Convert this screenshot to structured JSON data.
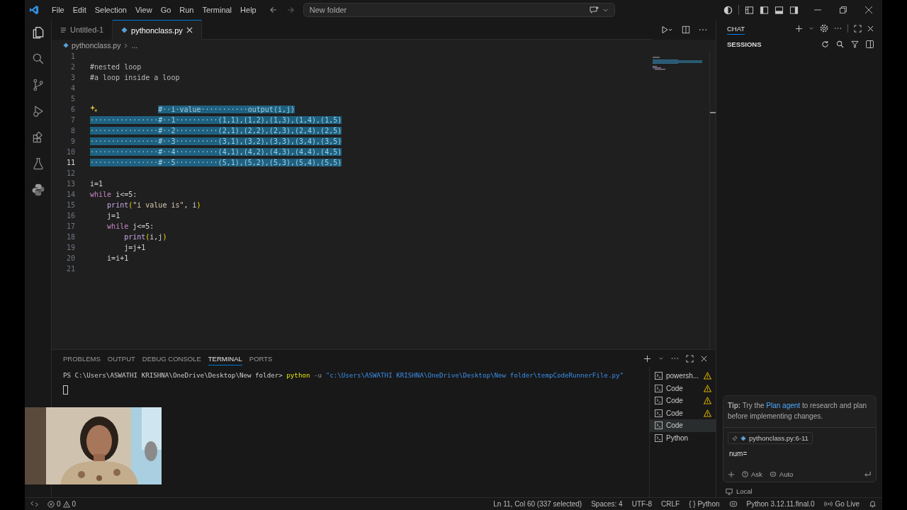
{
  "title_bar": {
    "menu": [
      "File",
      "Edit",
      "Selection",
      "View",
      "Go",
      "Run",
      "Terminal",
      "Help"
    ],
    "search": "New folder"
  },
  "editor": {
    "tabs": [
      {
        "label": "Untitled-1",
        "kind": "text",
        "selected": false
      },
      {
        "label": "pythonclass.py",
        "kind": "python",
        "selected": true
      }
    ],
    "breadcrumb": [
      "pythonclass.py",
      "..."
    ],
    "lines": [
      {
        "number": "1",
        "current": false,
        "hint": false
      },
      {
        "number": "2",
        "current": false,
        "hint": false,
        "tokens": [
          {
            "text": "#nested loop",
            "kind": "comment",
            "selected": false
          }
        ]
      },
      {
        "number": "3",
        "current": false,
        "hint": false,
        "tokens": [
          {
            "text": "#a loop inside a loop",
            "kind": "comment",
            "selected": false
          }
        ]
      },
      {
        "number": "4",
        "current": false,
        "hint": false
      },
      {
        "number": "5",
        "current": false,
        "hint": false
      },
      {
        "number": "6",
        "current": false,
        "hint": true,
        "tokens": [
          {
            "text": "                #··i·value···········output(i,j)",
            "kind": "comment",
            "selected": true
          }
        ]
      },
      {
        "number": "7",
        "current": false,
        "hint": false,
        "tokens": [
          {
            "text": "················#··1··········(1,1),(1,2),(1,3),(1,4),(1,5)",
            "kind": "comment",
            "selected": true
          }
        ]
      },
      {
        "number": "8",
        "current": false,
        "hint": false,
        "tokens": [
          {
            "text": "················#··2··········(2,1),(2,2),(2,3),(2,4),(2,5)",
            "kind": "comment",
            "selected": true
          }
        ]
      },
      {
        "number": "9",
        "current": false,
        "hint": false,
        "tokens": [
          {
            "text": "················#··3··········(3,1),(3,2),(3,3),(3,4),(3,5)",
            "kind": "comment",
            "selected": true
          }
        ]
      },
      {
        "number": "10",
        "current": false,
        "hint": false,
        "tokens": [
          {
            "text": "················#··4··········(4,1),(4,2),(4,3),(4,4),(4,5)",
            "kind": "comment",
            "selected": true
          }
        ]
      },
      {
        "number": "11",
        "current": true,
        "hint": false,
        "tokens": [
          {
            "text": "················#··5··········(5,1),(5,2),(5,3),(5,4),(5,5)",
            "kind": "comment",
            "selected": true
          }
        ]
      },
      {
        "number": "12",
        "current": false,
        "hint": false
      },
      {
        "number": "13",
        "current": false,
        "hint": false,
        "tokens": [
          {
            "text": "i=1",
            "kind": "plain",
            "selected": false
          }
        ]
      },
      {
        "number": "14",
        "current": false,
        "hint": false,
        "tokens": [
          {
            "text": "while",
            "kind": "keyword",
            "selected": false
          },
          {
            "text": " i<=5:",
            "kind": "plain",
            "selected": false
          }
        ]
      },
      {
        "number": "15",
        "current": false,
        "hint": false,
        "tokens": [
          {
            "text": "    print",
            "kind": "function",
            "selected": false
          },
          {
            "text": "(",
            "kind": "paren",
            "selected": false
          },
          {
            "text": "\"i value is\"",
            "kind": "string",
            "selected": false
          },
          {
            "text": ", i",
            "kind": "plain",
            "selected": false
          },
          {
            "text": ")",
            "kind": "paren",
            "selected": false
          }
        ]
      },
      {
        "number": "16",
        "current": false,
        "hint": false,
        "tokens": [
          {
            "text": "    j=1",
            "kind": "plain",
            "selected": false
          }
        ]
      },
      {
        "number": "17",
        "current": false,
        "hint": false,
        "tokens": [
          {
            "text": "    while",
            "kind": "keyword",
            "selected": false
          },
          {
            "text": " j<=5:",
            "kind": "plain",
            "selected": false
          }
        ]
      },
      {
        "number": "18",
        "current": false,
        "hint": false,
        "tokens": [
          {
            "text": "        print",
            "kind": "function",
            "selected": false
          },
          {
            "text": "(",
            "kind": "paren",
            "selected": false
          },
          {
            "text": "i,j",
            "kind": "plain",
            "selected": false
          },
          {
            "text": ")",
            "kind": "paren",
            "selected": false
          }
        ]
      },
      {
        "number": "19",
        "current": false,
        "hint": false,
        "tokens": [
          {
            "text": "        j=j+1",
            "kind": "plain",
            "selected": false
          }
        ]
      },
      {
        "number": "20",
        "current": false,
        "hint": false,
        "tokens": [
          {
            "text": "    i=i+1",
            "kind": "plain",
            "selected": false
          }
        ]
      },
      {
        "number": "21",
        "current": false,
        "hint": false
      }
    ]
  },
  "panel": {
    "tabs": [
      {
        "label": "PROBLEMS",
        "selected": false
      },
      {
        "label": "OUTPUT",
        "selected": false
      },
      {
        "label": "DEBUG CONSOLE",
        "selected": false
      },
      {
        "label": "TERMINAL",
        "selected": true
      },
      {
        "label": "PORTS",
        "selected": false
      }
    ],
    "terminal": [
      {
        "text": "PS C:\\Users\\ASWATHI KRISHNA\\OneDrive\\Desktop\\New folder> ",
        "kind": "plain"
      },
      {
        "text": "python",
        "kind": "command"
      },
      {
        "text": " -u ",
        "kind": "flag"
      },
      {
        "text": "\"c:\\Users\\ASWATHI KRISHNA\\OneDrive\\Desktop\\New folder\\tempCodeRunnerFile.py\"",
        "kind": "string"
      }
    ],
    "sessions": [
      {
        "label": "powersh...",
        "warning": true,
        "selected": false
      },
      {
        "label": "Code",
        "warning": true,
        "selected": false
      },
      {
        "label": "Code",
        "warning": true,
        "selected": false
      },
      {
        "label": "Code",
        "warning": true,
        "selected": false
      },
      {
        "label": "Code",
        "warning": false,
        "selected": true
      },
      {
        "label": "Python",
        "warning": false,
        "selected": false
      }
    ]
  },
  "chat": {
    "tab": "CHAT",
    "sessions_title": "SESSIONS",
    "tip": {
      "before": "**Tip:** Try the ",
      "link": "Plan agent",
      "after": " to research and plan before implementing changes."
    },
    "attachment": "pythonclass.py:6-11",
    "input": "num=",
    "modes": [
      "Ask",
      "Auto"
    ],
    "footer": "Local"
  },
  "status_bar": {
    "errors": "0",
    "warnings": "0",
    "items": [
      "Ln 11, Col 60 (337 selected)",
      "Spaces: 4",
      "UTF-8",
      "CRLF"
    ],
    "language_icon": "{ }",
    "language": "Python",
    "interpreter": "Python 3.12.11.final.0",
    "live": "Go Live"
  }
}
